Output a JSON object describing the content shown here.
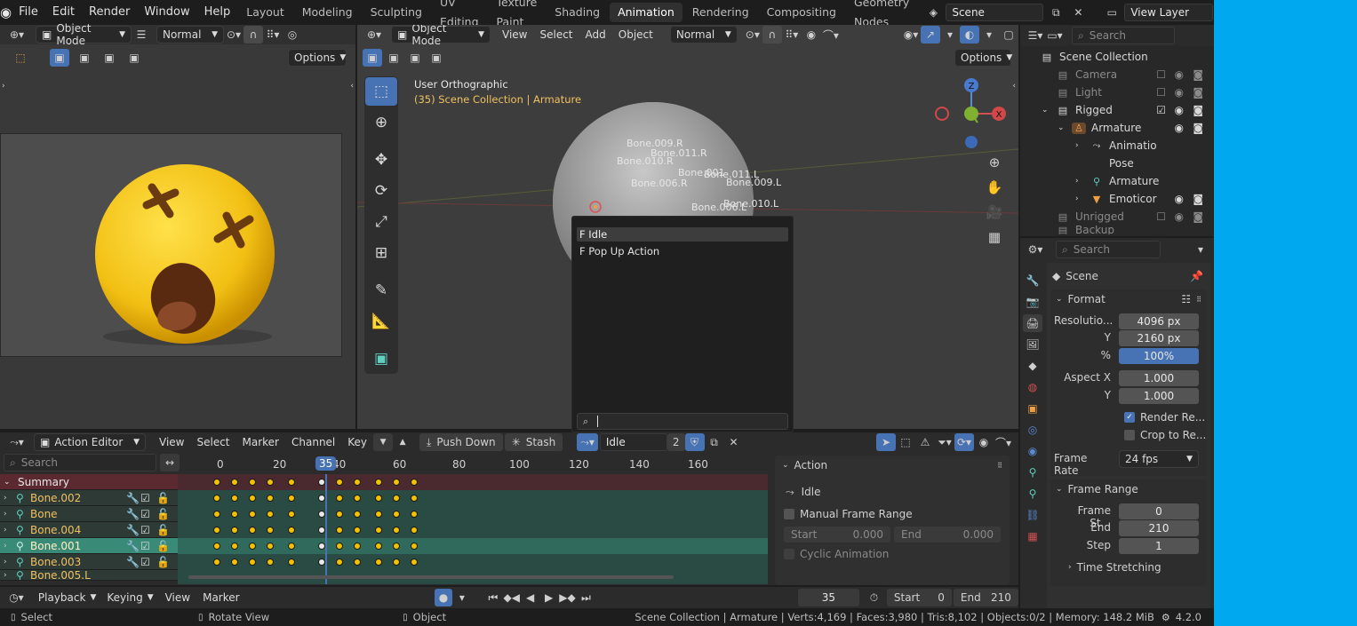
{
  "menubar": {
    "items": [
      "File",
      "Edit",
      "Render",
      "Window",
      "Help"
    ],
    "workspaces": [
      "Layout",
      "Modeling",
      "Sculpting",
      "UV Editing",
      "Texture Paint",
      "Shading",
      "Animation",
      "Rendering",
      "Compositing",
      "Geometry Nodes"
    ],
    "active_workspace": "Animation",
    "scene_name": "Scene",
    "view_layer": "View Layer"
  },
  "left_view": {
    "mode": "Object Mode",
    "shading": "Normal",
    "options": "Options"
  },
  "viewport": {
    "mode": "Object Mode",
    "menus": [
      "View",
      "Select",
      "Add",
      "Object"
    ],
    "orientation": "Normal",
    "options": "Options",
    "view_title": "User Orthographic",
    "view_subtitle": "(35) Scene Collection | Armature",
    "gizmo": {
      "z": "Z",
      "x": "X"
    },
    "bones": [
      "Bone.009.R",
      "Bone.011.R",
      "Bone.010.R",
      "Bone.001",
      "Bone.011.L",
      "Bone.006.R",
      "Bone.009.L",
      "Bone.006.L",
      "Bone.010.L"
    ]
  },
  "popup": {
    "items": [
      "F Idle",
      "F Pop Up Action"
    ],
    "selected_index": 0,
    "search_value": ""
  },
  "outliner": {
    "search_placeholder": "Search",
    "title": "Scene Collection",
    "rows": [
      {
        "label": "Camera",
        "dim": true
      },
      {
        "label": "Light",
        "dim": true
      },
      {
        "label": "Rigged",
        "dim": false
      },
      {
        "label": "Armature",
        "dim": false
      },
      {
        "label": "Animatio",
        "dim": false
      },
      {
        "label": "Pose",
        "dim": false
      },
      {
        "label": "Armature",
        "dim": false
      },
      {
        "label": "Emoticor",
        "dim": false
      },
      {
        "label": "Unrigged",
        "dim": true
      },
      {
        "label": "Backup",
        "dim": true
      }
    ]
  },
  "properties": {
    "search_placeholder": "Search",
    "context": "Scene",
    "format_title": "Format",
    "resolution_x_label": "Resolutio...",
    "resolution_x": "4096 px",
    "resolution_y_label": "Y",
    "resolution_y": "2160 px",
    "percent_label": "%",
    "percent": "100%",
    "aspect_x_label": "Aspect X",
    "aspect_x": "1.000",
    "aspect_y_label": "Y",
    "aspect_y": "1.000",
    "render_region": "Render Re...",
    "crop": "Crop to Re...",
    "frame_rate_label": "Frame Rate",
    "frame_rate": "24 fps",
    "frame_range_title": "Frame Range",
    "frame_start_label": "Frame St...",
    "frame_start": "0",
    "end_label": "End",
    "end": "210",
    "step_label": "Step",
    "step": "1",
    "time_stretching": "Time Stretching"
  },
  "action_editor": {
    "mode": "Action Editor",
    "menus": [
      "View",
      "Select",
      "Marker",
      "Channel",
      "Key"
    ],
    "push_down": "Push Down",
    "stash": "Stash",
    "action_name": "Idle",
    "users": "2",
    "search_placeholder": "Search",
    "frame_ticks": [
      "0",
      "20",
      "40",
      "60",
      "80",
      "100",
      "120",
      "140",
      "160"
    ],
    "current_frame": "35",
    "channels": [
      "Summary",
      "Bone.002",
      "Bone",
      "Bone.004",
      "Bone.001",
      "Bone.003",
      "Bone.005.L"
    ],
    "side_panel": {
      "title": "Action",
      "action": "Idle",
      "manual_range": "Manual Frame Range",
      "start_label": "Start",
      "start": "0.000",
      "end_label": "End",
      "end": "0.000",
      "cyclic": "Cyclic Animation"
    }
  },
  "timeline": {
    "menus": [
      "Playback",
      "Keying",
      "View",
      "Marker"
    ],
    "current_frame": "35",
    "start_label": "Start",
    "start": "0",
    "end_label": "End",
    "end": "210"
  },
  "statusbar": {
    "select": "Select",
    "rotate": "Rotate View",
    "object": "Object",
    "info": "Scene Collection | Armature | Verts:4,169 | Faces:3,980 | Tris:8,102 | Objects:0/2 | Memory: 148.2 MiB",
    "version": "4.2.0"
  }
}
